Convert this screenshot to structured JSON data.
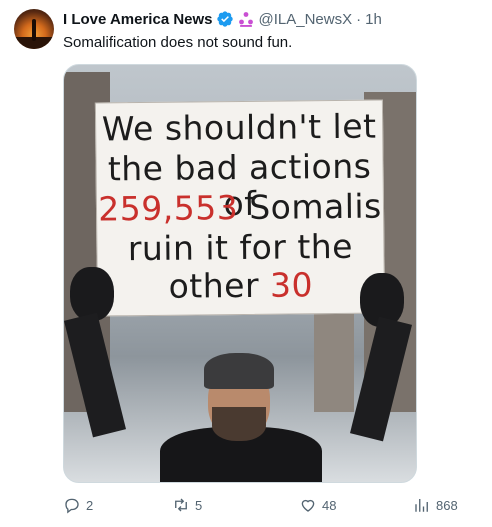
{
  "post": {
    "display_name": "I Love America News",
    "handle": "@ILA_NewsX",
    "separator": "·",
    "time": "1h",
    "text": "Somalification does not sound fun."
  },
  "media": {
    "sign_lines": [
      {
        "parts": [
          "We shouldn't let"
        ]
      },
      {
        "parts": [
          "the bad actions of"
        ]
      },
      {
        "red": "259,553",
        "rest": " Somalis"
      },
      {
        "parts": [
          "ruin it for the"
        ]
      },
      {
        "lead": "other ",
        "red": "30"
      }
    ]
  },
  "actions": {
    "replies": "2",
    "reposts": "5",
    "likes": "48",
    "views": "868"
  },
  "icons": {
    "verified": "verified-badge-icon",
    "affiliation": "affiliation-icon",
    "reply": "reply-icon",
    "repost": "repost-icon",
    "like": "heart-icon",
    "views": "views-chart-icon"
  },
  "colors": {
    "accent": "#1d9bf0",
    "affiliation": "#c94fd3",
    "muted": "#536471",
    "sign_red": "#c9302c"
  }
}
